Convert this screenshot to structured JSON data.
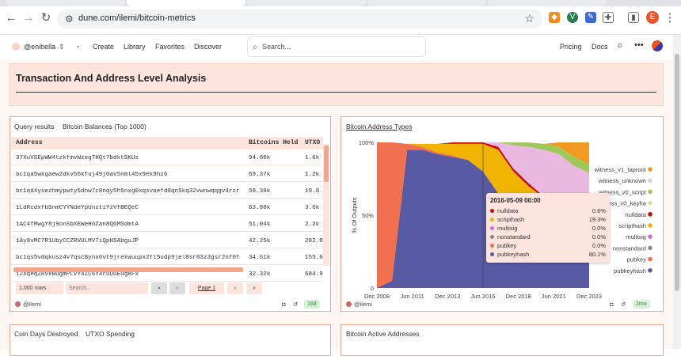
{
  "browser": {
    "url": "dune.com/ilemi/bitcoin-metrics",
    "profile_initial": "E"
  },
  "app": {
    "user": "@enibella",
    "nav": [
      "Create",
      "Library",
      "Favorites",
      "Discover"
    ],
    "search_placeholder": "Search...",
    "right_nav": [
      "Pricing",
      "Docs"
    ]
  },
  "section": {
    "title": "Transaction And Address Level Analysis"
  },
  "table_card": {
    "tab_label": "Query results",
    "title": "Bitcoin Balances (Top 1000)",
    "columns": [
      "Address",
      "Bitcoins Held",
      "UTXO"
    ],
    "rows": [
      [
        "37XuVSEpWW4tzkfmvWzegTHQt7bdktSKUs",
        "94.60k",
        "1.6k"
      ],
      [
        "bc1qa5wkgaew2dkv56kfuj49j0av5nml45x9ek9hz6",
        "69.37k",
        "1.2k"
      ],
      [
        "bc1qd4ysezhmypwty5dnw7c8nqy5h5nxg0xqsvaefd0qn5kq32vwnwqqgv4rzr",
        "59.38k",
        "19.8"
      ],
      [
        "1LdRcdxfbSnmCYYNdeYpUnztiYzVfBEQeC",
        "63.88k",
        "3.6k"
      ],
      [
        "1AC4fMwgY8j9onSbXEWeH6Zan8QGMSdmtA",
        "51.04k",
        "2.2k"
      ],
      [
        "1Ay8vMC7R1UbyCCZRVULMV7iQpHSAbguJP",
        "42.25k",
        "282.0"
      ],
      [
        "bc1qs5vdqkusz4v7qsc8ynx0vt9jrekwuupx2fl5udp9jel8sr83z3gsr2nf0f",
        "34.61k",
        "155.0"
      ],
      [
        "12XqeqZRVkBDgmPLVY4ZC6Y4ruUUEug8Fx",
        "32.32k",
        "684.9"
      ]
    ],
    "row_count": "1,000 rows",
    "search_placeholder": "Search...",
    "page_label": "Page 1",
    "author": "@ilemi",
    "age": "16d"
  },
  "chart_card": {
    "title": "Bitcoin Address Types",
    "author": "@ilemi",
    "age": "2mo",
    "tooltip": {
      "date": "2016-05-09 00:00",
      "rows": [
        {
          "name": "nulldata",
          "value": "0.6%",
          "color": "#c80c0c"
        },
        {
          "name": "scripthash",
          "value": "19.3%",
          "color": "#f0b400"
        },
        {
          "name": "multisig",
          "value": "0.0%",
          "color": "#cf6fd0"
        },
        {
          "name": "nonstandard",
          "value": "0.0%",
          "color": "#8a8a8a"
        },
        {
          "name": "pubkey",
          "value": "0.0%",
          "color": "#f07050"
        },
        {
          "name": "pubkeyhash",
          "value": "80.1%",
          "color": "#585aa4"
        }
      ]
    }
  },
  "chart_data": {
    "type": "area",
    "title": "Bitcoin Address Types",
    "ylabel": "% Of Outputs",
    "xlabel": "",
    "x_ticks": [
      "Dec 2008",
      "Jun 2011",
      "Dec 2013",
      "Jun 2016",
      "Dec 2018",
      "Jun 2021",
      "Dec 2023"
    ],
    "y_ticks": [
      "0",
      "50%",
      "100%"
    ],
    "ylim": [
      0,
      100
    ],
    "stacked": true,
    "legend_position": "right",
    "x": [
      "2009",
      "2010",
      "2011",
      "2012",
      "2013",
      "2014",
      "2015",
      "2016",
      "2017",
      "2018",
      "2019",
      "2020",
      "2021",
      "2022",
      "2023"
    ],
    "series": [
      {
        "name": "pubkeyhash",
        "color": "#585aa4",
        "values": [
          0,
          5,
          95,
          95,
          92,
          90,
          88,
          80,
          65,
          58,
          55,
          52,
          48,
          45,
          42
        ]
      },
      {
        "name": "pubkey",
        "color": "#f07050",
        "values": [
          100,
          95,
          4,
          2,
          1,
          1,
          0,
          0,
          0,
          0,
          0,
          0,
          0,
          0,
          0
        ]
      },
      {
        "name": "nonstandard",
        "color": "#8a8a8a",
        "values": [
          0,
          0,
          0,
          0,
          0,
          0,
          0,
          0,
          0,
          0,
          0,
          0,
          0,
          0,
          0
        ]
      },
      {
        "name": "multisig",
        "color": "#cf6fd0",
        "values": [
          0,
          0,
          0,
          0,
          0,
          0,
          0,
          0,
          0,
          0,
          0,
          0,
          0,
          0,
          0
        ]
      },
      {
        "name": "scripthash",
        "color": "#f0b400",
        "values": [
          0,
          0,
          0,
          2,
          6,
          8,
          11,
          19,
          30,
          22,
          15,
          10,
          8,
          8,
          8
        ]
      },
      {
        "name": "nulldata",
        "color": "#c80c0c",
        "values": [
          0,
          0,
          0,
          0,
          0,
          1,
          1,
          1,
          2,
          2,
          2,
          1,
          1,
          1,
          1
        ]
      },
      {
        "name": "witness_v0_keyhash",
        "color": "#e8b8e0",
        "values": [
          0,
          0,
          0,
          0,
          0,
          0,
          0,
          0,
          3,
          16,
          25,
          32,
          35,
          30,
          28
        ]
      },
      {
        "name": "witness_v0_script",
        "color": "#9ec85a",
        "values": [
          0,
          0,
          0,
          0,
          0,
          0,
          0,
          0,
          0,
          2,
          3,
          4,
          5,
          6,
          6
        ]
      },
      {
        "name": "witness_unknown",
        "color": "#d8d8d8",
        "values": [
          0,
          0,
          0,
          0,
          0,
          0,
          0,
          0,
          0,
          0,
          0,
          0,
          0,
          0,
          0
        ]
      },
      {
        "name": "witness_v1_taproot",
        "color": "#ee9a20",
        "values": [
          0,
          0,
          0,
          0,
          0,
          0,
          0,
          0,
          0,
          0,
          0,
          0,
          3,
          10,
          15
        ]
      }
    ],
    "legend_order": [
      "witness_v1_taproot",
      "witness_unknown",
      "witness_v0_script",
      "witness_v0_keyha",
      "nulldata",
      "scripthash",
      "multisig",
      "nonstandard",
      "pubkey",
      "pubkeyhash"
    ],
    "legend_colors": [
      "#ee9a20",
      "#d8d8d8",
      "#9ec85a",
      "#cfe2b0",
      "#c80c0c",
      "#f0b400",
      "#cf6fd0",
      "#8a8a8a",
      "#f07050",
      "#585aa4"
    ]
  },
  "bottom_cards": {
    "left_tab": "Coin Days Destroyed",
    "left_title": "UTXO Spending",
    "right_title": "Bitcoin Active Addresses"
  }
}
